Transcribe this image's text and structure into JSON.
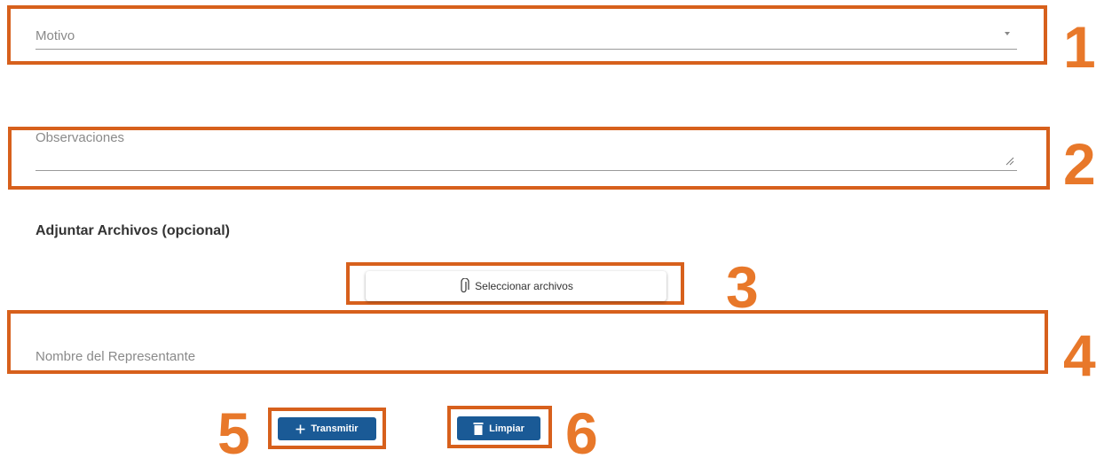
{
  "form": {
    "motivo": {
      "placeholder": "Motivo",
      "dropdown_icon": "caret-down-icon"
    },
    "observaciones": {
      "placeholder": "Observaciones",
      "resize_icon": "resize-handle-icon"
    },
    "adjuntar": {
      "title": "Adjuntar Archivos (opcional)",
      "button_label": "Seleccionar archivos",
      "button_icon": "paperclip-icon"
    },
    "representante": {
      "placeholder": "Nombre del Representante"
    },
    "transmitir_button": {
      "label": "Transmitir",
      "icon": "plus-icon"
    },
    "limpiar_button": {
      "label": "Limpiar",
      "icon": "trash-icon"
    }
  },
  "callouts": [
    "1",
    "2",
    "3",
    "4",
    "5",
    "6"
  ],
  "colors": {
    "callout": "#D7601C",
    "number": "#E8782A",
    "button_primary": "#1a5a96"
  }
}
